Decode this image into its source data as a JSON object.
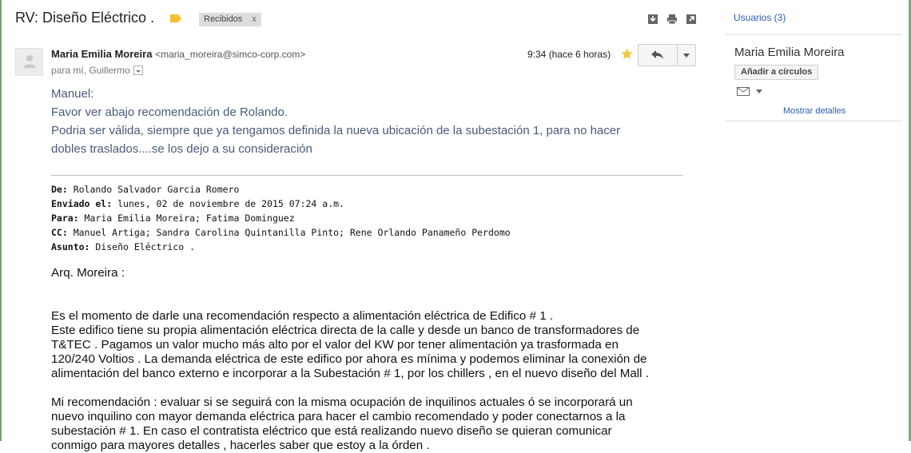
{
  "header": {
    "subject": "RV: Diseño Eléctrico .",
    "label_chip": "Recibidos",
    "label_chip_close": "x",
    "icons": [
      "download-icon",
      "print-icon",
      "open-new-window-icon"
    ]
  },
  "message": {
    "sender_name": "Maria Emilia Moreira",
    "sender_email": "<maria_moreira@simco-corp.com>",
    "recipients": "para mí, Guillermo",
    "time": "9:34 (hace 6 horas)",
    "starred": true
  },
  "intro": {
    "line1": "Manuel:",
    "line2": "Favor ver abajo recomendación de Rolando.",
    "line3": "Podria ser válida, siempre que ya tengamos definida la nueva ubicación de la subestación 1, para no hacer",
    "line4": "dobles traslados....se los dejo a su consideración"
  },
  "forwarded": {
    "from_label": "De:",
    "from_value": " Rolando Salvador Garcia Romero",
    "sent_label": "Enviado el:",
    "sent_value": " lunes, 02 de noviembre de 2015 07:24 a.m.",
    "to_label": "Para:",
    "to_value": " Maria Emilia Moreira; Fatima Dominguez",
    "cc_label": "CC:",
    "cc_value": " Manuel Artiga; Sandra Carolina Quintanilla Pinto; Rene Orlando Panameño Perdomo",
    "subject_label": "Asunto:",
    "subject_value": " Diseño Eléctrico ."
  },
  "body": {
    "greeting": "Arq. Moreira :",
    "p1": [
      "Es el momento de darle una recomendación respecto a alimentación eléctrica de Edifico  # 1 .",
      "Este edifico tiene su propia alimentación eléctrica directa de la calle y desde un banco de transformadores de",
      "T&TEC . Pagamos un valor mucho más alto por el valor del KW por tener alimentación ya trasformada en",
      "120/240 Voltios . La demanda eléctrica de este edifico por ahora es mínima y podemos eliminar la conexión de",
      "alimentación del banco externo e incorporar a la Subestación # 1, por los chillers , en el nuevo diseño del Mall ."
    ],
    "p2": [
      "Mi recomendación : evaluar si se seguirá con la misma ocupación de inquilinos actuales ó se incorporará un",
      "nuevo inquilino con mayor demanda eléctrica para hacer el cambio recomendado y poder conectarnos a la",
      "subestación # 1. En caso el contratista eléctrico que está realizando nuevo diseño se quieran comunicar",
      "conmigo para mayores detalles , hacerles saber que estoy a la órden ."
    ]
  },
  "sidebar": {
    "users": "Usuarios (3)",
    "contact_name": "Maria Emilia Moreira",
    "add_circles": "Añadir a círculos",
    "show_details": "Mostrar detalles"
  },
  "colors": {
    "label": "#f2c12e",
    "link": "#2a5db0",
    "intro_text": "#4a5a7a",
    "star": "#f4c542"
  }
}
